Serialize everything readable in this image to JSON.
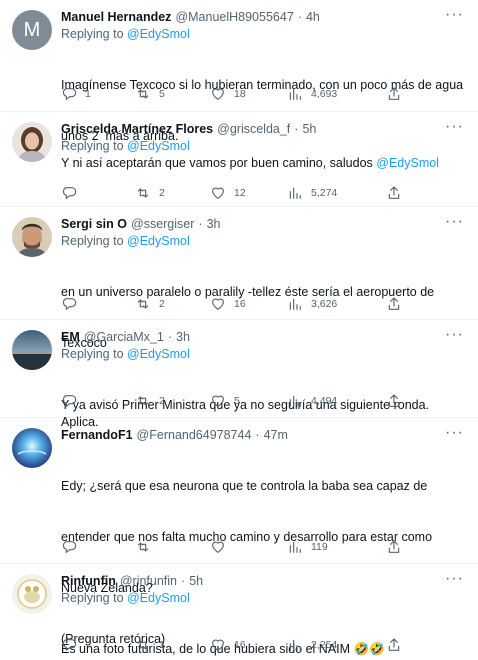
{
  "tweets": [
    {
      "name": "Manuel Hernandez",
      "handle": "@ManuelH89055647",
      "time": "4h",
      "reply_prefix": "Replying to",
      "reply_to": "@EdySmol",
      "text_lines": [
        "Imagínense Texcoco si lo hubieran terminado, con un poco más de agua",
        "unos 2  más a arriba."
      ],
      "text_mention": "",
      "replies": "1",
      "retweets": "5",
      "likes": "18",
      "views": "4,693",
      "avatar_letter": "M",
      "avatar_color": "#7f8c97"
    },
    {
      "name": "Griscelda Martínez Flores",
      "handle": "@griscelda_f",
      "time": "5h",
      "reply_prefix": "Replying to",
      "reply_to": "@EdySmol",
      "text_lines": [
        "Y ni así aceptarán que vamos por buen camino, saludos "
      ],
      "text_mention": "@EdySmol",
      "replies": "",
      "retweets": "2",
      "likes": "12",
      "views": "5,274"
    },
    {
      "name": "Sergi sin O",
      "handle": "@ssergiser",
      "time": "3h",
      "reply_prefix": "Replying to",
      "reply_to": "@EdySmol",
      "text_lines": [
        "en un universo paralelo o paralily -tellez éste sería el aeropuerto de",
        "Texcoco"
      ],
      "text_mention": "",
      "replies": "",
      "retweets": "2",
      "likes": "16",
      "views": "3,626"
    },
    {
      "name": "EM",
      "handle": "@GarciaMx_1",
      "time": "3h",
      "reply_prefix": "Replying to",
      "reply_to": "@EdySmol",
      "text_lines": [
        "Y ya avisó Primer Ministra que ya no seguiría una siguiente ronda. Aplica."
      ],
      "text_mention": "",
      "replies": "",
      "retweets": "2",
      "likes": "5",
      "views": "4,494"
    },
    {
      "name": "FernandoF1",
      "handle": "@Fernand64978744",
      "time": "47m",
      "reply_prefix": "",
      "reply_to": "",
      "text_lines": [
        "Edy; ¿será que esa neurona que te controla la baba sea capaz de",
        "entender que nos falta mucho camino y desarrollo para estar como",
        "Nueva Zelanda?",
        "(Pregunta retórica)"
      ],
      "text_mention": "",
      "replies": "",
      "retweets": "",
      "likes": "",
      "views": "119"
    },
    {
      "name": "Rinfunfin",
      "handle": "@rinfunfin",
      "time": "5h",
      "reply_prefix": "Replying to",
      "reply_to": "@EdySmol",
      "text_lines": [
        "Es una foto futurista, de lo que hubiera sido el NAIM 🤣🤣"
      ],
      "text_mention": "",
      "replies": "",
      "retweets": "1",
      "likes": "16",
      "views": "2,254"
    }
  ],
  "dot": "·",
  "more_glyph": "···"
}
